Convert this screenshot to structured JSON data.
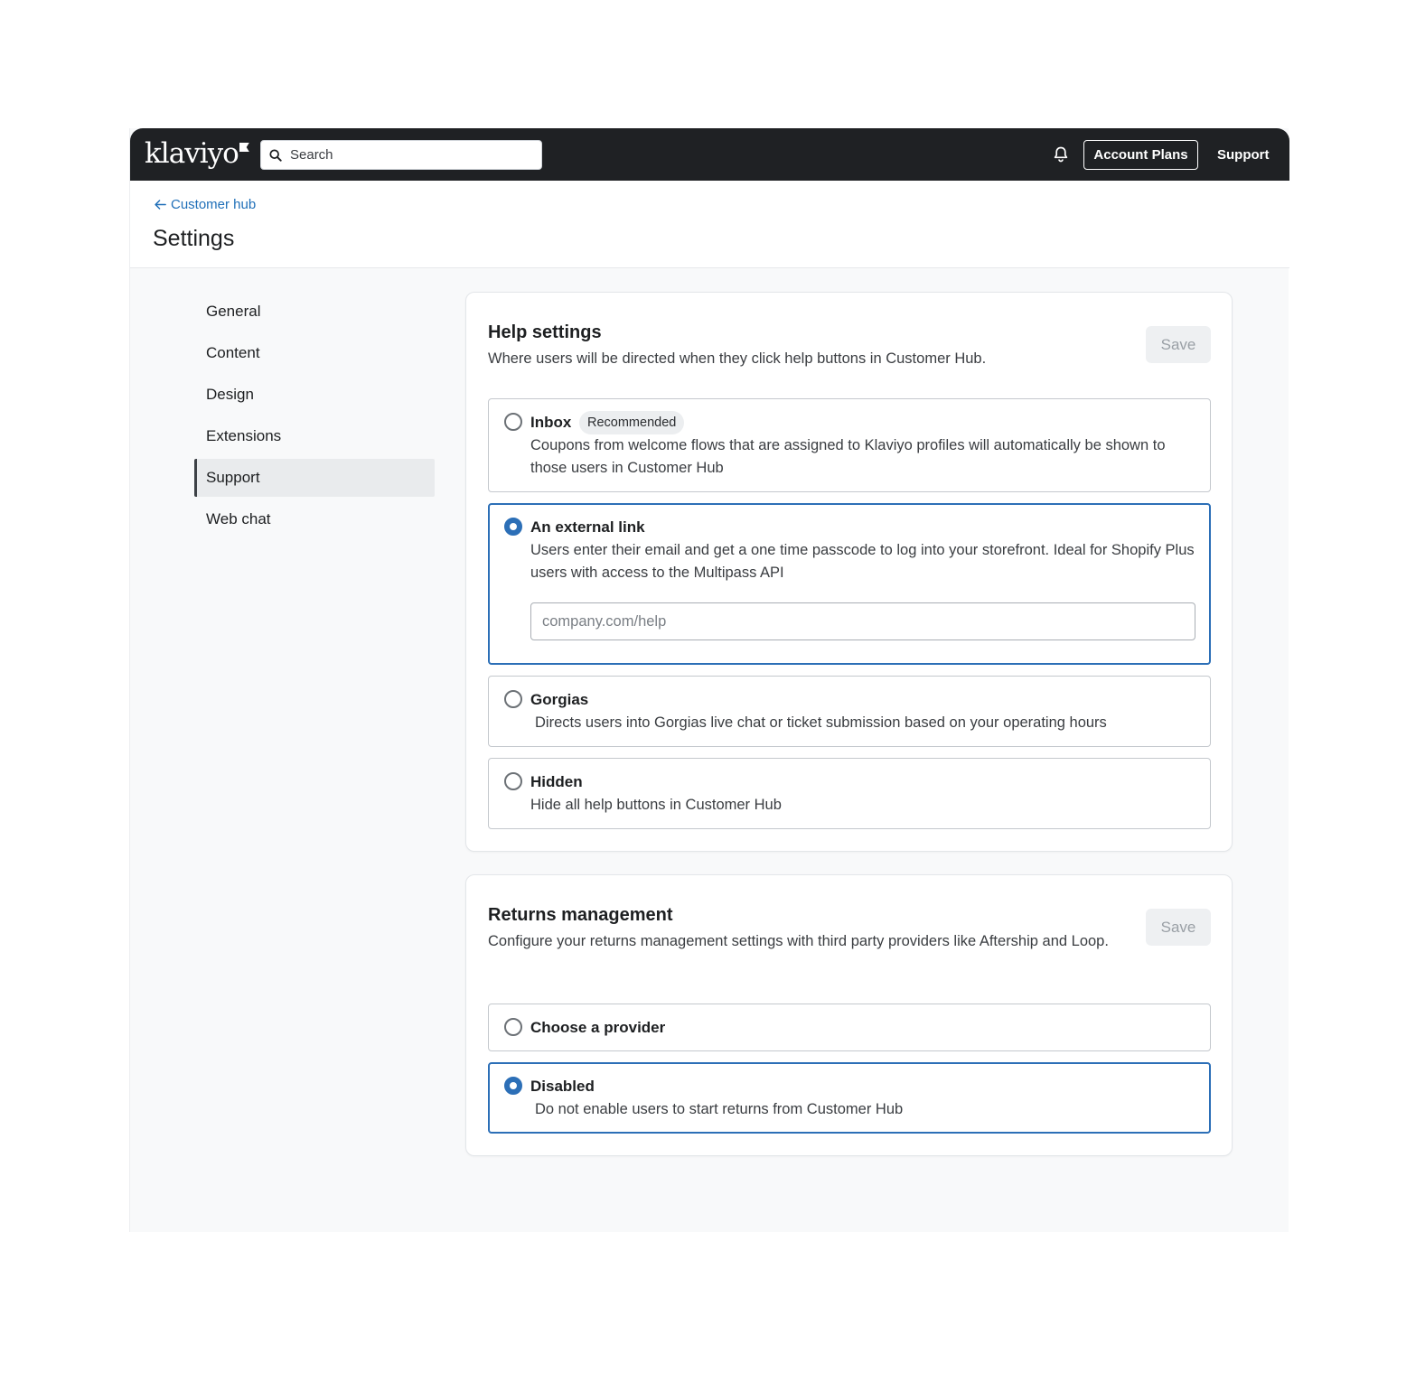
{
  "brand": {
    "logo_text": "klaviyo"
  },
  "topbar": {
    "search_placeholder": "Search",
    "account_plans_label": "Account Plans",
    "support_label": "Support"
  },
  "header": {
    "back_label": "Customer hub",
    "title": "Settings"
  },
  "sidebar": {
    "items": [
      {
        "label": "General",
        "active": false
      },
      {
        "label": "Content",
        "active": false
      },
      {
        "label": "Design",
        "active": false
      },
      {
        "label": "Extensions",
        "active": false
      },
      {
        "label": "Support",
        "active": true
      },
      {
        "label": "Web chat",
        "active": false
      }
    ]
  },
  "help_settings": {
    "title": "Help settings",
    "description": "Where users will be directed when they click help buttons in Customer Hub.",
    "save_label": "Save",
    "options": [
      {
        "label": "Inbox",
        "badge": "Recommended",
        "description": "Coupons from welcome flows that are assigned to Klaviyo profiles will automatically be shown to those users in Customer Hub",
        "selected": false
      },
      {
        "label": "An external link",
        "description": "Users enter their email and get a one time passcode to log into your storefront. Ideal for Shopify Plus users with access to the Multipass API",
        "input_placeholder": "company.com/help",
        "input_value": "",
        "selected": true
      },
      {
        "label": "Gorgias",
        "description": "Directs users into Gorgias live chat or ticket submission based on your operating hours",
        "selected": false
      },
      {
        "label": "Hidden",
        "description": "Hide all help buttons in Customer Hub",
        "selected": false
      }
    ]
  },
  "returns_management": {
    "title": "Returns management",
    "description": "Configure your returns management settings with third party providers like Aftership and Loop.",
    "save_label": "Save",
    "options": [
      {
        "label": "Choose a provider",
        "selected": false
      },
      {
        "label": "Disabled",
        "description": "Do not enable users to start returns from Customer Hub",
        "selected": true
      }
    ]
  },
  "colors": {
    "topbar_bg": "#1f2124",
    "accent": "#2c6fb7",
    "link": "#1f6fb8",
    "page_bg": "#f8f9fa"
  },
  "icons": {
    "search": "search-icon",
    "bell": "bell-icon",
    "back": "arrow-left-icon"
  }
}
